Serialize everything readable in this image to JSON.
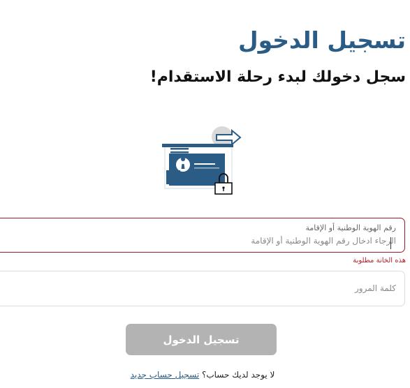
{
  "header": {
    "title": "تسجيل الدخول",
    "subtitle": "سجل دخولك لبدء رحلة الاستقدام!"
  },
  "illustration": {
    "icon": "id-card-lock-illustration"
  },
  "form": {
    "id_field": {
      "label": "رقم الهوية الوطنية أو الإقامة",
      "placeholder": "الرجاء ادخال رقم الهوية الوطنية أو الإقامة",
      "value": "",
      "error": "هذه الخانة مطلوبة"
    },
    "password_field": {
      "placeholder": "كلمة المرور",
      "value": ""
    },
    "submit_label": "تسجيل الدخول"
  },
  "footer": {
    "prompt": "لا يوجد لديك حساب؟",
    "register_link": "تسجيل حساب جديد"
  },
  "colors": {
    "accent": "#2a5c86",
    "error": "#b4232e",
    "button_disabled": "#b3b3b3"
  }
}
